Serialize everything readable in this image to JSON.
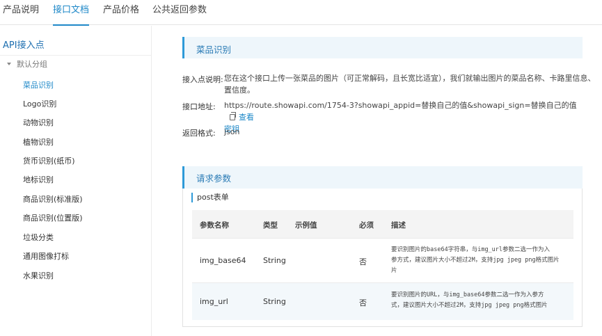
{
  "top_tabs": [
    {
      "label": "产品说明",
      "active": false
    },
    {
      "label": "接口文档",
      "active": true
    },
    {
      "label": "产品价格",
      "active": false
    },
    {
      "label": "公共返回参数",
      "active": false
    }
  ],
  "sidebar": {
    "title": "API接入点",
    "group_label": "默认分组",
    "items": [
      {
        "label": "菜品识别",
        "active": true
      },
      {
        "label": "Logo识别",
        "active": false
      },
      {
        "label": "动物识别",
        "active": false
      },
      {
        "label": "植物识别",
        "active": false
      },
      {
        "label": "货币识别(纸币)",
        "active": false
      },
      {
        "label": "地标识别",
        "active": false
      },
      {
        "label": "商品识别(标准版)",
        "active": false
      },
      {
        "label": "商品识别(位置版)",
        "active": false
      },
      {
        "label": "垃圾分类",
        "active": false
      },
      {
        "label": "通用图像打标",
        "active": false
      },
      {
        "label": "水果识别",
        "active": false
      }
    ]
  },
  "api_section": {
    "title": "菜品识别",
    "desc_label": "接入点说明:",
    "desc_line1": "您在这个接口上传一张菜品的图片（可正常解码，且长宽比适宜），我们就输出图片的菜品名称、卡路里信息、",
    "desc_line2": "置信度。",
    "url_label": "接口地址:",
    "url_value": "https://route.showapi.com/1754-3?showapi_appid=替换自己的值&showapi_sign=替换自己的值",
    "view_key_part1": "查看",
    "view_key_part2": "密钥",
    "format_label": "返回格式:",
    "format_value": "json"
  },
  "params_section": {
    "title": "请求参数",
    "form_type": "post表单",
    "headers": {
      "name": "参数名称",
      "type": "类型",
      "example": "示例值",
      "required": "必须",
      "desc": "描述"
    },
    "rows": [
      {
        "name": "img_base64",
        "type": "String",
        "example": "",
        "required": "否",
        "desc_line1": "要识别图片的base64字符串，与img_url参数二选一作为入",
        "desc_line2": "参方式，建议图片大小不超过2M，支持jpg jpeg png格式图片",
        "desc_line3": "片"
      },
      {
        "name": "img_url",
        "type": "String",
        "example": "",
        "required": "否",
        "desc_line1": "要识别图片的URL，与img_base64参数二选一作为入参方",
        "desc_line2": "式，建议图片大小不超过2M，支持jpg jpeg png格式图片"
      }
    ]
  },
  "colors": {
    "accent": "#1e88c8",
    "section_header_bg": "#eef6fb"
  }
}
